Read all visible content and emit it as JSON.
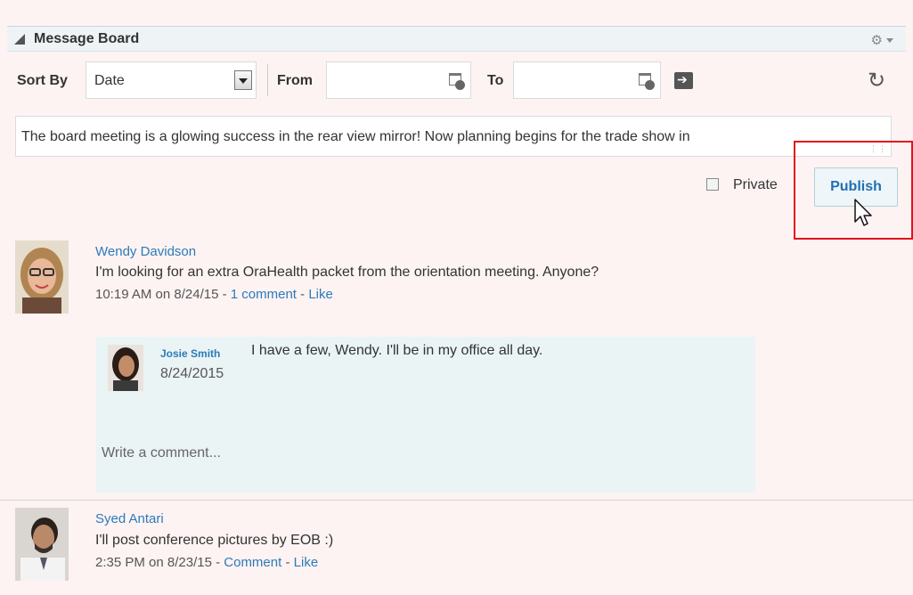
{
  "panel": {
    "title": "Message Board"
  },
  "toolbar": {
    "sort_by_label": "Sort By",
    "sort_value": "Date",
    "from_label": "From",
    "from_value": "",
    "to_label": "To",
    "to_value": ""
  },
  "composer": {
    "text": "The board meeting is a glowing success in the rear view mirror! Now planning begins for the trade show in",
    "private_label": "Private",
    "private_checked": false,
    "publish_label": "Publish"
  },
  "posts": [
    {
      "author": "Wendy Davidson",
      "message": "I'm looking for an extra OraHealth packet from the orientation meeting. Anyone?",
      "timestamp": "10:19 AM on 8/24/15 - ",
      "comment_link": "1 comment",
      "separator": " - ",
      "like_label": "Like",
      "comments": [
        {
          "author": "Josie Smith",
          "text": "I have a few, Wendy. I'll be in my office all day.",
          "date": "8/24/2015"
        }
      ],
      "write_comment_placeholder": "Write a comment..."
    },
    {
      "author": "Syed Antari",
      "message": "I'll post conference pictures by EOB :)",
      "timestamp": "2:35 PM on 8/23/15 - ",
      "comment_link": "Comment",
      "separator": " - ",
      "like_label": "Like"
    }
  ],
  "colors": {
    "accent": "#2c7bb8",
    "highlight": "#e1141b",
    "background": "#fdf3f3"
  }
}
